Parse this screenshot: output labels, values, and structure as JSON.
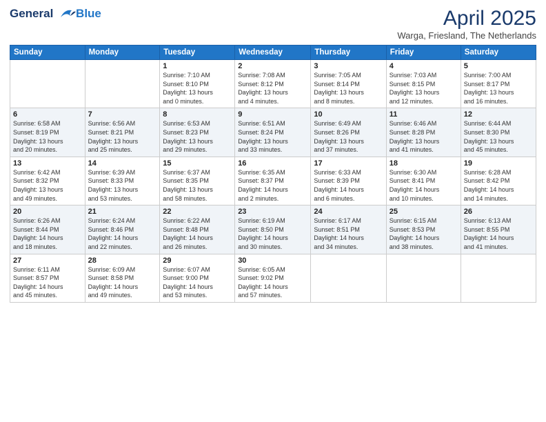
{
  "header": {
    "logo_line1": "General",
    "logo_line2": "Blue",
    "month_title": "April 2025",
    "subtitle": "Warga, Friesland, The Netherlands"
  },
  "weekdays": [
    "Sunday",
    "Monday",
    "Tuesday",
    "Wednesday",
    "Thursday",
    "Friday",
    "Saturday"
  ],
  "weeks": [
    [
      {
        "day": "",
        "info": ""
      },
      {
        "day": "",
        "info": ""
      },
      {
        "day": "1",
        "info": "Sunrise: 7:10 AM\nSunset: 8:10 PM\nDaylight: 13 hours\nand 0 minutes."
      },
      {
        "day": "2",
        "info": "Sunrise: 7:08 AM\nSunset: 8:12 PM\nDaylight: 13 hours\nand 4 minutes."
      },
      {
        "day": "3",
        "info": "Sunrise: 7:05 AM\nSunset: 8:14 PM\nDaylight: 13 hours\nand 8 minutes."
      },
      {
        "day": "4",
        "info": "Sunrise: 7:03 AM\nSunset: 8:15 PM\nDaylight: 13 hours\nand 12 minutes."
      },
      {
        "day": "5",
        "info": "Sunrise: 7:00 AM\nSunset: 8:17 PM\nDaylight: 13 hours\nand 16 minutes."
      }
    ],
    [
      {
        "day": "6",
        "info": "Sunrise: 6:58 AM\nSunset: 8:19 PM\nDaylight: 13 hours\nand 20 minutes."
      },
      {
        "day": "7",
        "info": "Sunrise: 6:56 AM\nSunset: 8:21 PM\nDaylight: 13 hours\nand 25 minutes."
      },
      {
        "day": "8",
        "info": "Sunrise: 6:53 AM\nSunset: 8:23 PM\nDaylight: 13 hours\nand 29 minutes."
      },
      {
        "day": "9",
        "info": "Sunrise: 6:51 AM\nSunset: 8:24 PM\nDaylight: 13 hours\nand 33 minutes."
      },
      {
        "day": "10",
        "info": "Sunrise: 6:49 AM\nSunset: 8:26 PM\nDaylight: 13 hours\nand 37 minutes."
      },
      {
        "day": "11",
        "info": "Sunrise: 6:46 AM\nSunset: 8:28 PM\nDaylight: 13 hours\nand 41 minutes."
      },
      {
        "day": "12",
        "info": "Sunrise: 6:44 AM\nSunset: 8:30 PM\nDaylight: 13 hours\nand 45 minutes."
      }
    ],
    [
      {
        "day": "13",
        "info": "Sunrise: 6:42 AM\nSunset: 8:32 PM\nDaylight: 13 hours\nand 49 minutes."
      },
      {
        "day": "14",
        "info": "Sunrise: 6:39 AM\nSunset: 8:33 PM\nDaylight: 13 hours\nand 53 minutes."
      },
      {
        "day": "15",
        "info": "Sunrise: 6:37 AM\nSunset: 8:35 PM\nDaylight: 13 hours\nand 58 minutes."
      },
      {
        "day": "16",
        "info": "Sunrise: 6:35 AM\nSunset: 8:37 PM\nDaylight: 14 hours\nand 2 minutes."
      },
      {
        "day": "17",
        "info": "Sunrise: 6:33 AM\nSunset: 8:39 PM\nDaylight: 14 hours\nand 6 minutes."
      },
      {
        "day": "18",
        "info": "Sunrise: 6:30 AM\nSunset: 8:41 PM\nDaylight: 14 hours\nand 10 minutes."
      },
      {
        "day": "19",
        "info": "Sunrise: 6:28 AM\nSunset: 8:42 PM\nDaylight: 14 hours\nand 14 minutes."
      }
    ],
    [
      {
        "day": "20",
        "info": "Sunrise: 6:26 AM\nSunset: 8:44 PM\nDaylight: 14 hours\nand 18 minutes."
      },
      {
        "day": "21",
        "info": "Sunrise: 6:24 AM\nSunset: 8:46 PM\nDaylight: 14 hours\nand 22 minutes."
      },
      {
        "day": "22",
        "info": "Sunrise: 6:22 AM\nSunset: 8:48 PM\nDaylight: 14 hours\nand 26 minutes."
      },
      {
        "day": "23",
        "info": "Sunrise: 6:19 AM\nSunset: 8:50 PM\nDaylight: 14 hours\nand 30 minutes."
      },
      {
        "day": "24",
        "info": "Sunrise: 6:17 AM\nSunset: 8:51 PM\nDaylight: 14 hours\nand 34 minutes."
      },
      {
        "day": "25",
        "info": "Sunrise: 6:15 AM\nSunset: 8:53 PM\nDaylight: 14 hours\nand 38 minutes."
      },
      {
        "day": "26",
        "info": "Sunrise: 6:13 AM\nSunset: 8:55 PM\nDaylight: 14 hours\nand 41 minutes."
      }
    ],
    [
      {
        "day": "27",
        "info": "Sunrise: 6:11 AM\nSunset: 8:57 PM\nDaylight: 14 hours\nand 45 minutes."
      },
      {
        "day": "28",
        "info": "Sunrise: 6:09 AM\nSunset: 8:58 PM\nDaylight: 14 hours\nand 49 minutes."
      },
      {
        "day": "29",
        "info": "Sunrise: 6:07 AM\nSunset: 9:00 PM\nDaylight: 14 hours\nand 53 minutes."
      },
      {
        "day": "30",
        "info": "Sunrise: 6:05 AM\nSunset: 9:02 PM\nDaylight: 14 hours\nand 57 minutes."
      },
      {
        "day": "",
        "info": ""
      },
      {
        "day": "",
        "info": ""
      },
      {
        "day": "",
        "info": ""
      }
    ]
  ]
}
